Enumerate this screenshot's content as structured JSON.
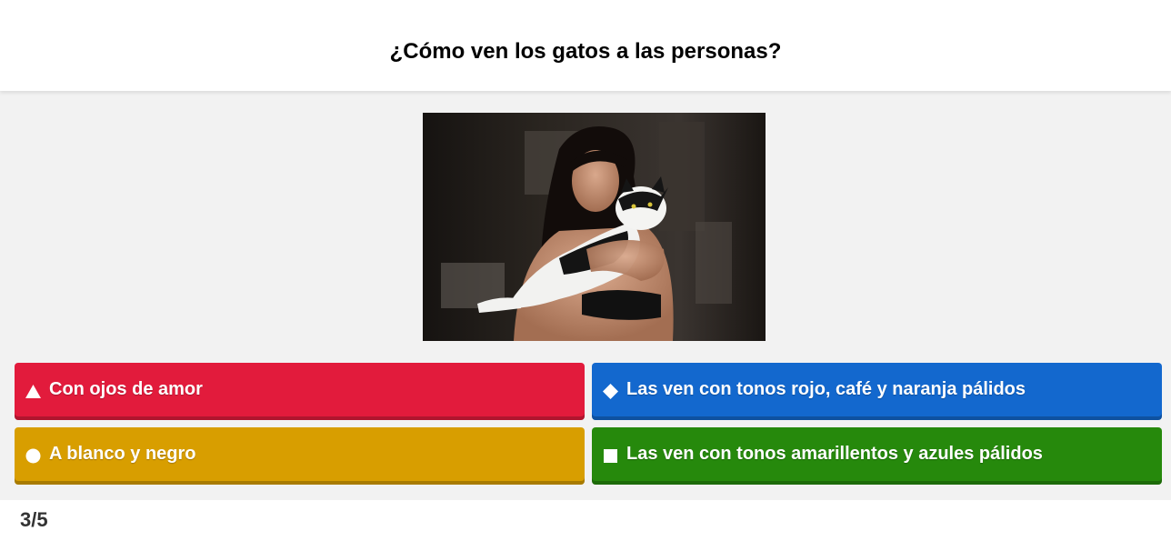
{
  "question": {
    "text": "¿Cómo ven los gatos a las personas?"
  },
  "media": {
    "description": "photo-woman-holding-cat"
  },
  "answers": [
    {
      "label": "Con ojos de amor",
      "shape": "triangle-icon",
      "color": "#e21b3c"
    },
    {
      "label": "Las ven con tonos rojo, café y naranja pálidos",
      "shape": "diamond-icon",
      "color": "#1368ce"
    },
    {
      "label": "A blanco y negro",
      "shape": "circle-icon",
      "color": "#d89e00"
    },
    {
      "label": "Las ven con tonos amarillentos y azules pálidos",
      "shape": "square-icon",
      "color": "#26890c"
    }
  ],
  "progress": {
    "counter": "3/5"
  }
}
